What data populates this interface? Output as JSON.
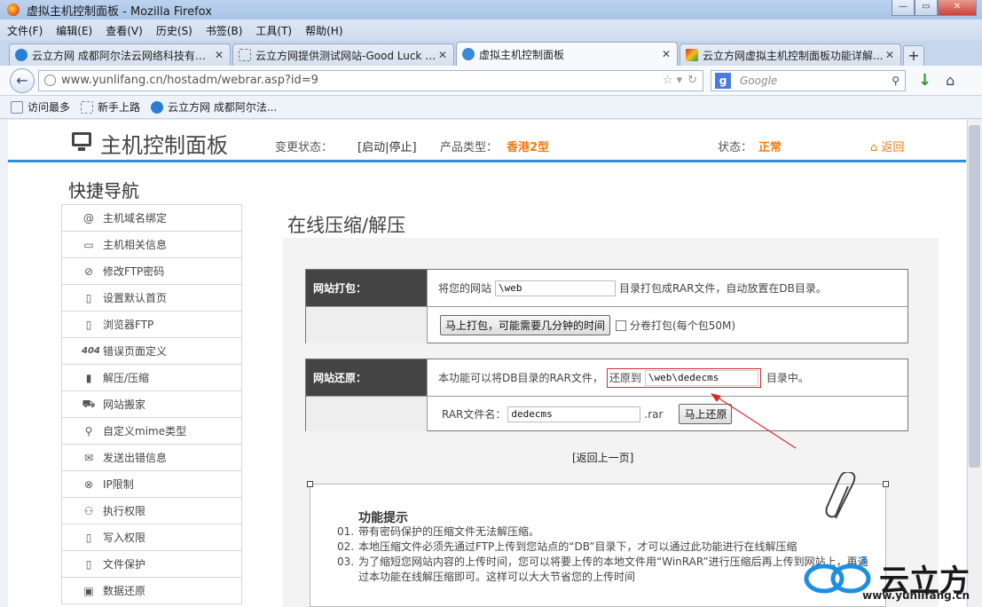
{
  "window": {
    "title": "虚拟主机控制面板 - Mozilla Firefox"
  },
  "menu": [
    "文件(F)",
    "编辑(E)",
    "查看(V)",
    "历史(S)",
    "书签(B)",
    "工具(T)",
    "帮助(H)"
  ],
  "tabs": [
    {
      "label": "云立方网 成都阿尔法云网络科技有限...",
      "color": "#2a7fd4"
    },
    {
      "label": "云立方网提供测试网站-Good Luck T...",
      "color": "#ffffff"
    },
    {
      "label": "虚拟主机控制面板",
      "color": "#3a8ad8"
    },
    {
      "label": "云立方网虚拟主机控制面板功能详解...",
      "color": "#d22a2a"
    }
  ],
  "nav": {
    "url": "www.yunlifang.cn/hostadm/webrar.asp?id=9",
    "search_placeholder": "Google",
    "search_engine": "g"
  },
  "bookmarks": [
    "访问最多",
    "新手上路",
    "云立方网 成都阿尔法..."
  ],
  "header": {
    "title": "主机控制面板",
    "change_status_label": "变更状态：",
    "change_status_value": "[启动|停止]",
    "product_label": "产品类型：",
    "product_value": "香港2型",
    "status_label": "状态：",
    "status_value": "正常",
    "back": "返回"
  },
  "quicknav": {
    "title": "快捷导航",
    "items": [
      {
        "label": "主机域名绑定",
        "icon": "@"
      },
      {
        "label": "主机相关信息",
        "icon": "▭"
      },
      {
        "label": "修改FTP密码",
        "icon": "⊘"
      },
      {
        "label": "设置默认首页",
        "icon": "▯"
      },
      {
        "label": "浏览器FTP",
        "icon": "▯"
      },
      {
        "label": "错误页面定义",
        "icon": "404"
      },
      {
        "label": "解压/压缩",
        "icon": "▮"
      },
      {
        "label": "网站搬家",
        "icon": "⛟"
      },
      {
        "label": "自定义mime类型",
        "icon": "⚲"
      },
      {
        "label": "发送出错信息",
        "icon": "✉"
      },
      {
        "label": "IP限制",
        "icon": "⊗"
      },
      {
        "label": "执行权限",
        "icon": "⚇"
      },
      {
        "label": "写入权限",
        "icon": "▯"
      },
      {
        "label": "文件保护",
        "icon": "▯"
      },
      {
        "label": "数据还原",
        "icon": "▣"
      }
    ]
  },
  "main": {
    "title": "在线压缩/解压",
    "pack": {
      "label": "网站打包：",
      "prefix": "将您的网站",
      "path_value": "\\web",
      "suffix": "目录打包成RAR文件，自动放置在DB目录。",
      "button": "马上打包，可能需要几分钟的时间",
      "split_label": "分卷打包(每个包50M)"
    },
    "restore": {
      "label": "网站还原：",
      "prefix": "本功能可以将DB目录的RAR文件，",
      "restore_to": "还原到",
      "path_value": "\\web\\dedecms",
      "suffix": "目录中。",
      "rar_label": "RAR文件名：",
      "rar_value": "dedecms",
      "rar_ext": ".rar",
      "button": "马上还原"
    },
    "back_link": "[返回上一页]",
    "tips": {
      "title": "功能提示",
      "items": [
        {
          "n": "01.",
          "text": "带有密码保护的压缩文件无法解压缩。"
        },
        {
          "n": "02.",
          "text": "本地压缩文件必须先通过FTP上传到您站点的“DB”目录下，才可以通过此功能进行在线解压缩"
        },
        {
          "n": "03.",
          "text": "为了缩短您网站内容的上传时间，您可以将要上传的本地文件用“WinRAR”进行压缩后再上传到网站上，再通"
        },
        {
          "n": "",
          "text": "过本功能在线解压缩即可。这样可以大大节省您的上传时间"
        }
      ]
    }
  },
  "brand": {
    "name": "云立方",
    "url": "www.yunlifang.cn"
  }
}
